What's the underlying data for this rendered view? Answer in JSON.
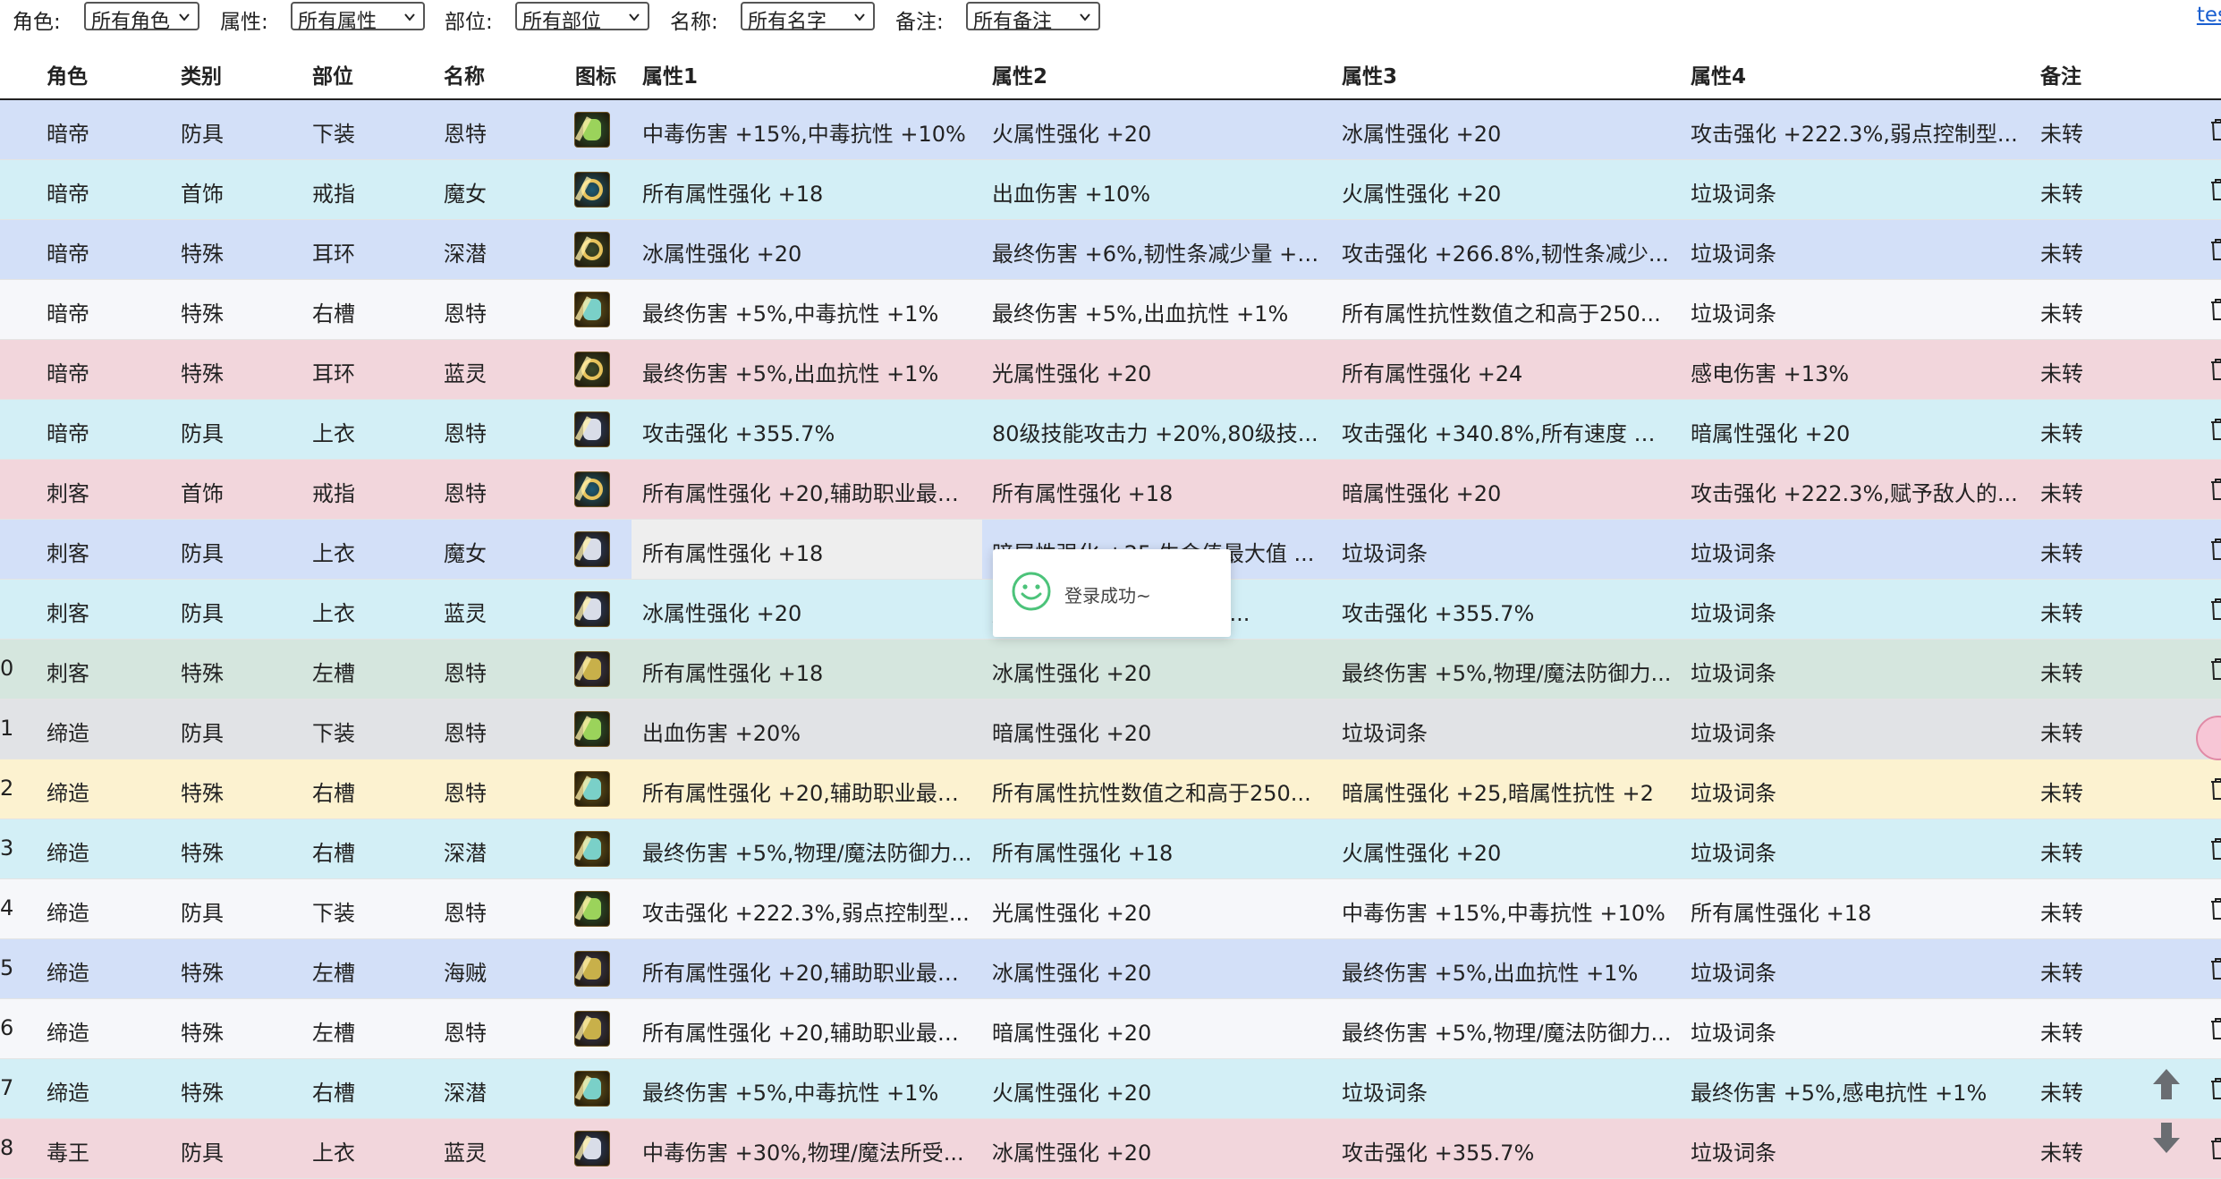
{
  "filters": [
    {
      "label": "角色:",
      "value": "所有角色"
    },
    {
      "label": "属性:",
      "value": "所有属性"
    },
    {
      "label": "部位:",
      "value": "所有部位"
    },
    {
      "label": "名称:",
      "value": "所有名字"
    },
    {
      "label": "备注:",
      "value": "所有备注"
    }
  ],
  "top_link": "tes",
  "columns": {
    "role": "角色",
    "category": "类别",
    "slot": "部位",
    "name": "名称",
    "icon": "图标",
    "attr1": "属性1",
    "attr2": "属性2",
    "attr3": "属性3",
    "attr4": "属性4",
    "note": "备注"
  },
  "rows": [
    {
      "idx": "",
      "role": "暗帝",
      "category": "防具",
      "slot": "下装",
      "name": "恩特",
      "icon": "armor-pants-icon",
      "attr1": "中毒伤害 +15%,中毒抗性 +10%",
      "attr2": "火属性强化 +20",
      "attr3": "冰属性强化 +20",
      "attr4": "攻击强化 +222.3%,弱点控制型...",
      "note": "未转",
      "bg": "#d3e0f8"
    },
    {
      "idx": "",
      "role": "暗帝",
      "category": "首饰",
      "slot": "戒指",
      "name": "魔女",
      "icon": "ring-icon",
      "attr1": "所有属性强化 +18",
      "attr2": "出血伤害 +10%",
      "attr3": "火属性强化 +20",
      "attr4": "垃圾词条",
      "note": "未转",
      "bg": "#d3eff6"
    },
    {
      "idx": "",
      "role": "暗帝",
      "category": "特殊",
      "slot": "耳环",
      "name": "深潜",
      "icon": "earring-icon",
      "attr1": "冰属性强化 +20",
      "attr2": "最终伤害 +6%,韧性条减少量 +1...",
      "attr3": "攻击强化 +266.8%,韧性条减少...",
      "attr4": "垃圾词条",
      "note": "未转",
      "bg": "#d3e0f8"
    },
    {
      "idx": "",
      "role": "暗帝",
      "category": "特殊",
      "slot": "右槽",
      "name": "恩特",
      "icon": "slot-right-icon",
      "attr1": "最终伤害 +5%,中毒抗性 +1%",
      "attr2": "最终伤害 +5%,出血抗性 +1%",
      "attr3": "所有属性抗性数值之和高于250...",
      "attr4": "垃圾词条",
      "note": "未转",
      "bg": "#f6f7fa"
    },
    {
      "idx": "",
      "role": "暗帝",
      "category": "特殊",
      "slot": "耳环",
      "name": "蓝灵",
      "icon": "earring-icon",
      "attr1": "最终伤害 +5%,出血抗性 +1%",
      "attr2": "光属性强化 +20",
      "attr3": "所有属性强化 +24",
      "attr4": "感电伤害 +13%",
      "note": "未转",
      "bg": "#f2d6dc"
    },
    {
      "idx": "",
      "role": "暗帝",
      "category": "防具",
      "slot": "上衣",
      "name": "恩特",
      "icon": "armor-top-icon",
      "attr1": "攻击强化 +355.7%",
      "attr2": "80级技能攻击力 +20%,80级技...",
      "attr3": "攻击强化 +340.8%,所有速度 +2...",
      "attr4": "暗属性强化 +20",
      "note": "未转",
      "bg": "#d3eff6"
    },
    {
      "idx": "",
      "role": "刺客",
      "category": "首饰",
      "slot": "戒指",
      "name": "恩特",
      "icon": "ring-icon",
      "attr1": "所有属性强化 +20,辅助职业最终...",
      "attr2": "所有属性强化 +18",
      "attr3": "暗属性强化 +20",
      "attr4": "攻击强化 +222.3%,赋予敌人的...",
      "note": "未转",
      "bg": "#f2d6dc"
    },
    {
      "idx": "",
      "role": "刺客",
      "category": "防具",
      "slot": "上衣",
      "name": "魔女",
      "icon": "armor-top-icon",
      "attr1": "所有属性强化 +18",
      "attr2": "暗属性强化 +25,生命值最大值 ...",
      "attr3": "垃圾词条",
      "attr4": "垃圾词条",
      "note": "未转",
      "bg": "#d3e0f8"
    },
    {
      "idx": "",
      "role": "刺客",
      "category": "防具",
      "slot": "上衣",
      "name": "蓝灵",
      "icon": "armor-top-icon",
      "attr1": "冰属性强化 +20",
      "attr2": "魔法攻击力 +5%,法所受...",
      "attr3": "攻击强化 +355.7%",
      "attr4": "垃圾词条",
      "note": "未转",
      "bg": "#d3eff6"
    },
    {
      "idx": "0",
      "role": "刺客",
      "category": "特殊",
      "slot": "左槽",
      "name": "恩特",
      "icon": "slot-left-icon",
      "attr1": "所有属性强化 +18",
      "attr2": "冰属性强化 +20",
      "attr3": "最终伤害 +5%,物理/魔法防御力...",
      "attr4": "垃圾词条",
      "note": "未转",
      "bg": "#d5e6de"
    },
    {
      "idx": "1",
      "role": "缔造",
      "category": "防具",
      "slot": "下装",
      "name": "恩特",
      "icon": "armor-pants-icon",
      "attr1": "出血伤害 +20%",
      "attr2": "暗属性强化 +20",
      "attr3": "垃圾词条",
      "attr4": "垃圾词条",
      "note": "未转",
      "bg": "#e1e3e6"
    },
    {
      "idx": "2",
      "role": "缔造",
      "category": "特殊",
      "slot": "右槽",
      "name": "恩特",
      "icon": "slot-right-icon",
      "attr1": "所有属性强化 +20,辅助职业最终...",
      "attr2": "所有属性抗性数值之和高于250...",
      "attr3": "暗属性强化 +25,暗属性抗性 +2",
      "attr4": "垃圾词条",
      "note": "未转",
      "bg": "#fcf2d0"
    },
    {
      "idx": "3",
      "role": "缔造",
      "category": "特殊",
      "slot": "右槽",
      "name": "深潜",
      "icon": "slot-right-icon",
      "attr1": "最终伤害 +5%,物理/魔法防御力...",
      "attr2": "所有属性强化 +18",
      "attr3": "火属性强化 +20",
      "attr4": "垃圾词条",
      "note": "未转",
      "bg": "#d3eff6"
    },
    {
      "idx": "4",
      "role": "缔造",
      "category": "防具",
      "slot": "下装",
      "name": "恩特",
      "icon": "armor-pants-icon",
      "attr1": "攻击强化 +222.3%,弱点控制型...",
      "attr2": "光属性强化 +20",
      "attr3": "中毒伤害 +15%,中毒抗性 +10%",
      "attr4": "所有属性强化 +18",
      "note": "未转",
      "bg": "#f6f7fa"
    },
    {
      "idx": "5",
      "role": "缔造",
      "category": "特殊",
      "slot": "左槽",
      "name": "海贼",
      "icon": "slot-left-icon",
      "attr1": "所有属性强化 +20,辅助职业最终...",
      "attr2": "冰属性强化 +20",
      "attr3": "最终伤害 +5%,出血抗性 +1%",
      "attr4": "垃圾词条",
      "note": "未转",
      "bg": "#d3e0f8"
    },
    {
      "idx": "6",
      "role": "缔造",
      "category": "特殊",
      "slot": "左槽",
      "name": "恩特",
      "icon": "slot-left-icon",
      "attr1": "所有属性强化 +20,辅助职业最终...",
      "attr2": "暗属性强化 +20",
      "attr3": "最终伤害 +5%,物理/魔法防御力...",
      "attr4": "垃圾词条",
      "note": "未转",
      "bg": "#f6f7fa"
    },
    {
      "idx": "7",
      "role": "缔造",
      "category": "特殊",
      "slot": "右槽",
      "name": "深潜",
      "icon": "slot-right-icon",
      "attr1": "最终伤害 +5%,中毒抗性 +1%",
      "attr2": "火属性强化 +20",
      "attr3": "垃圾词条",
      "attr4": "最终伤害 +5%,感电抗性 +1%",
      "note": "未转",
      "bg": "#d3eff6"
    },
    {
      "idx": "8",
      "role": "毒王",
      "category": "防具",
      "slot": "上衣",
      "name": "蓝灵",
      "icon": "armor-top-icon",
      "attr1": "中毒伤害 +30%,物理/魔法所受...",
      "attr2": "冰属性强化 +20",
      "attr3": "攻击强化 +355.7%",
      "attr4": "垃圾词条",
      "note": "未转",
      "bg": "#f2d6dc"
    }
  ],
  "toast": {
    "message": "登录成功~",
    "icon": "smiley-icon"
  },
  "scroll": {
    "up_icon": "arrow-up-icon",
    "down_icon": "arrow-down-icon"
  }
}
